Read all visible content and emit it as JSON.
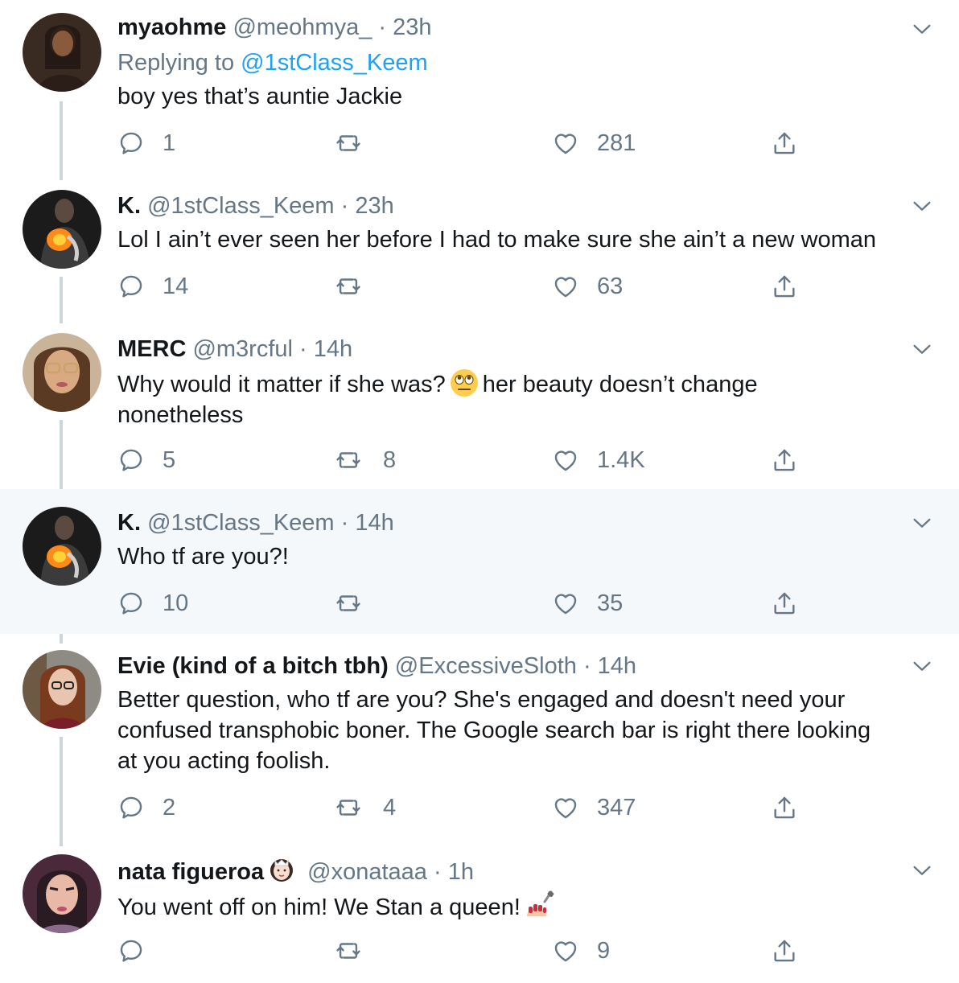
{
  "colors": {
    "link": "#1da1f2",
    "muted": "#657786",
    "thread_line": "#ccd6dd",
    "highlight_bg": "#f5f8fa"
  },
  "tweets": [
    {
      "name": "myaohme",
      "handle": "@meohmya_",
      "time": "· 23h",
      "replying_label": "Replying to",
      "replying_to": "@1stClass_Keem",
      "text": "boy yes that’s auntie Jackie",
      "replies": "1",
      "retweets": "",
      "likes": "281"
    },
    {
      "name": "K.",
      "handle": "@1stClass_Keem",
      "time": "· 23h",
      "text": "Lol I ain’t ever seen her before I had to make sure she ain’t a new woman",
      "replies": "14",
      "retweets": "",
      "likes": "63"
    },
    {
      "name": "MERC",
      "handle": "@m3rcful",
      "time": "· 14h",
      "text_before": "Why would it matter if she was?",
      "emoji": "face-with-rolling-eyes-emoji",
      "text_after": "her beauty doesn’t change",
      "text_line2": "nonetheless",
      "replies": "5",
      "retweets": "8",
      "likes": "1.4K"
    },
    {
      "name": "K.",
      "handle": "@1stClass_Keem",
      "time": "· 14h",
      "text": "Who tf are you?!",
      "replies": "10",
      "retweets": "",
      "likes": "35"
    },
    {
      "name": "Evie (kind of a bitch tbh)",
      "handle": "@ExcessiveSloth",
      "time": "· 14h",
      "text_line1": "Better question, who tf are you? She's engaged and doesn't need your",
      "text_line2": "confused transphobic boner. The Google search bar is right there looking",
      "text_line3": "at you acting foolish.",
      "replies": "2",
      "retweets": "4",
      "likes": "347"
    },
    {
      "name": "nata figueroa",
      "name_emoji": "princess-emoji",
      "handle": "@xonataaa",
      "time": "· 1h",
      "text": "You went off on him! We Stan a queen!",
      "emoji": "nail-polish-emoji",
      "replies": "",
      "retweets": "",
      "likes": "9"
    }
  ]
}
